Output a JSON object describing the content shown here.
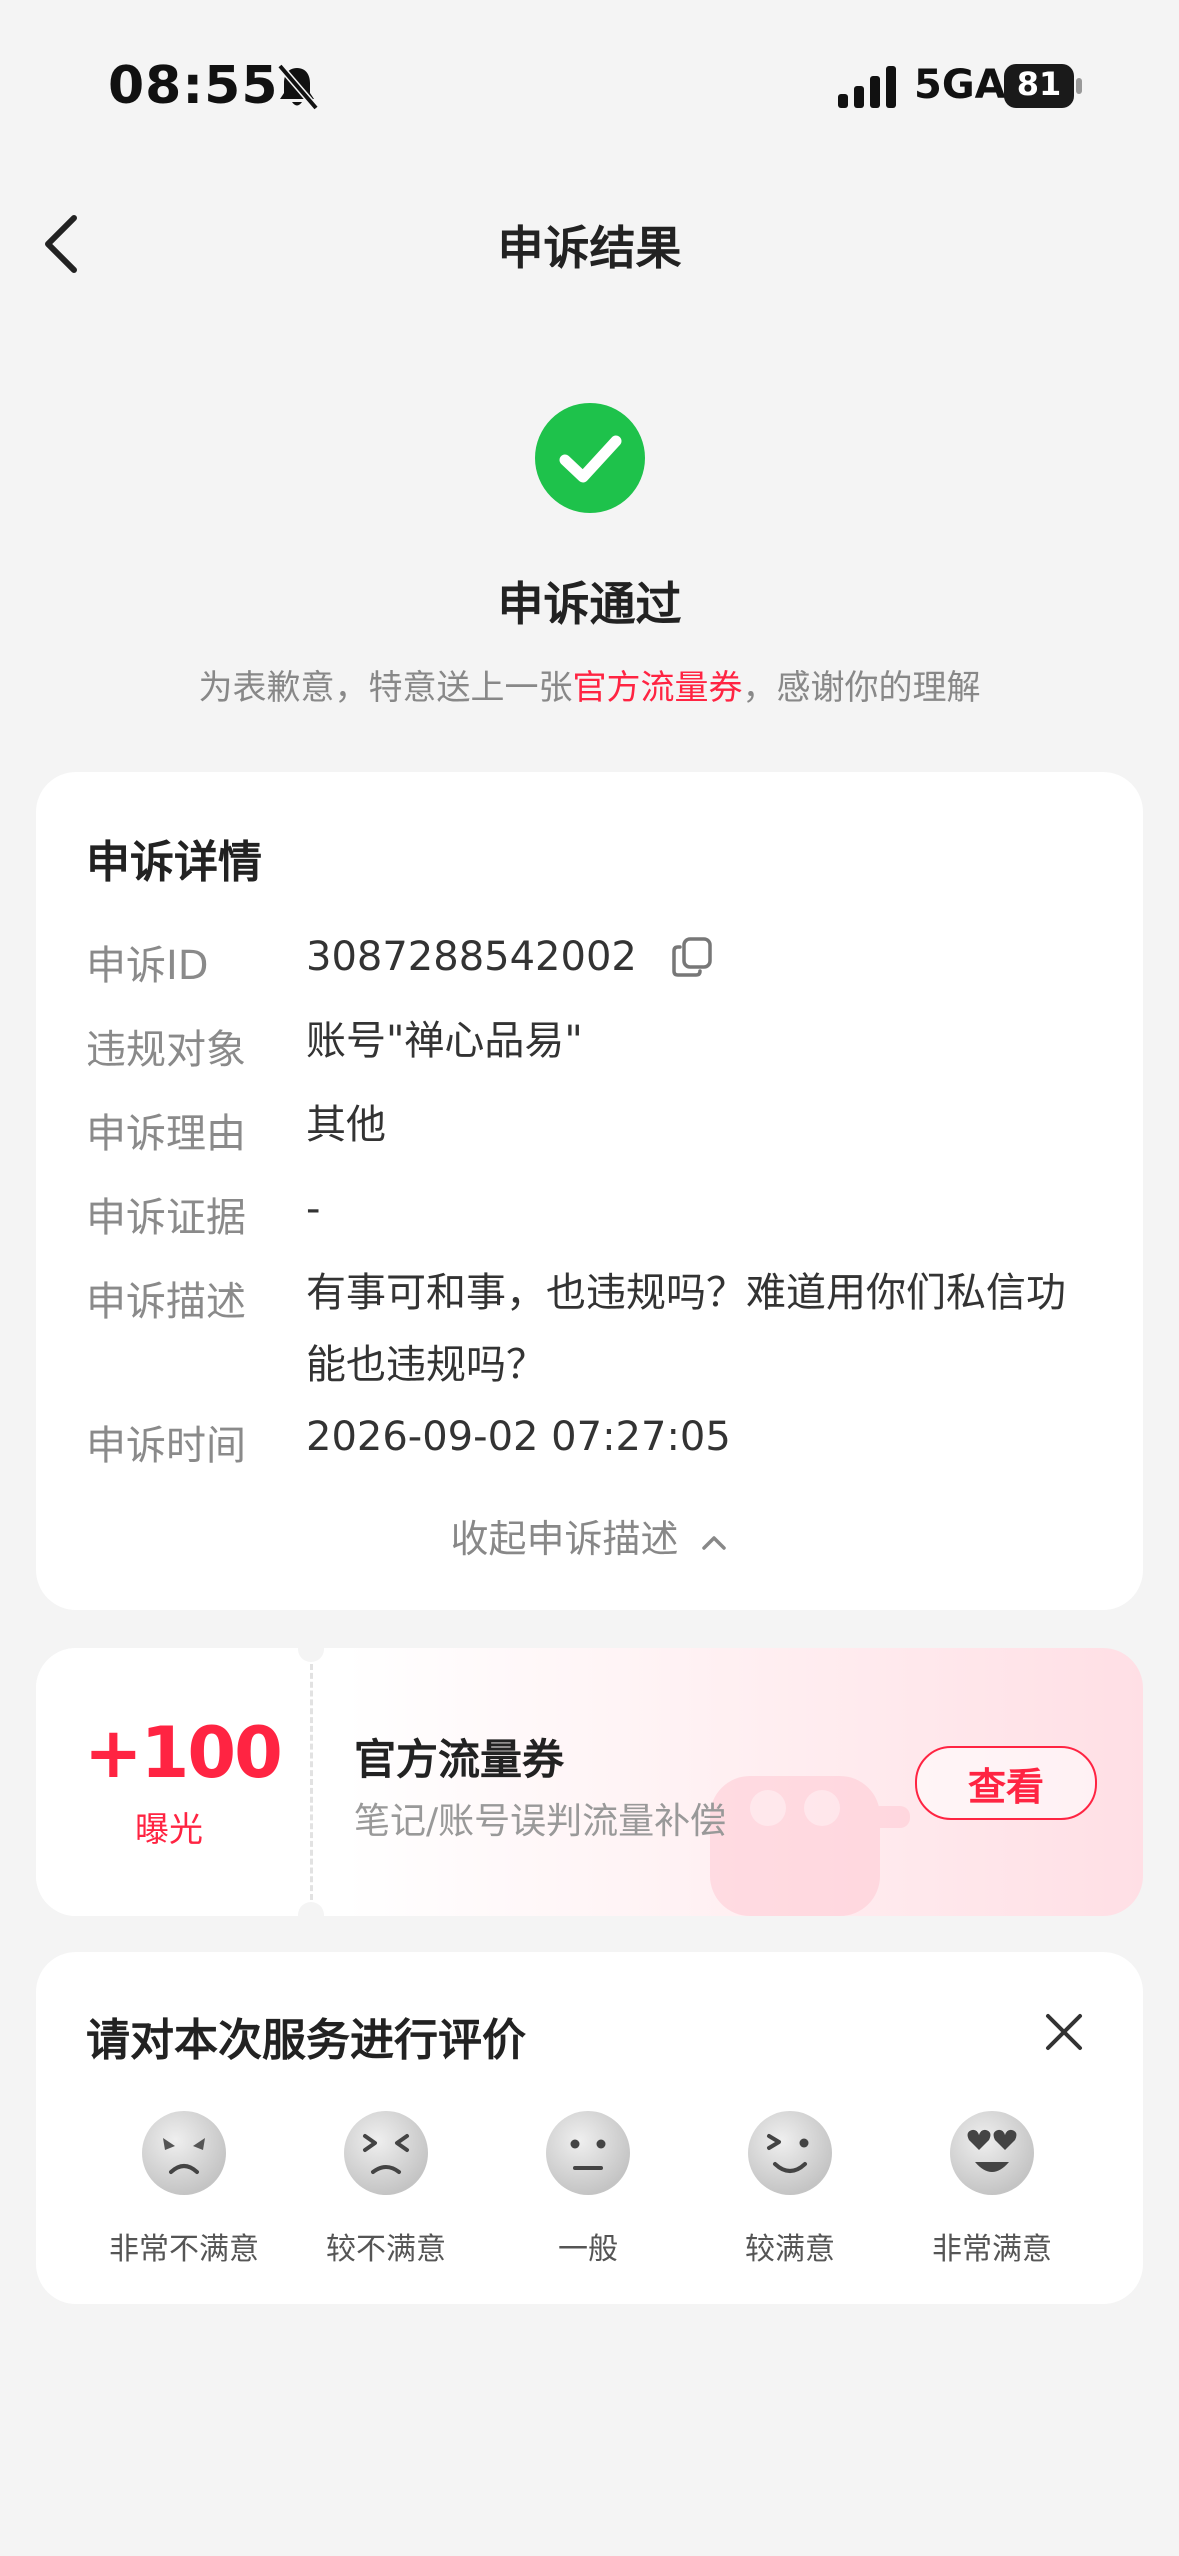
{
  "status_bar": {
    "time": "08:55",
    "network": "5GA",
    "battery": "81"
  },
  "nav": {
    "title": "申诉结果"
  },
  "result": {
    "title": "申诉通过",
    "subtitle_before": "为表歉意，特意送上一张",
    "subtitle_highlight": "官方流量券",
    "subtitle_after": "，感谢你的理解",
    "highlight_color": "#ff2442",
    "success_color": "#1ec24b"
  },
  "details": {
    "title": "申诉详情",
    "rows": [
      {
        "label": "申诉ID",
        "value": "3087288542002"
      },
      {
        "label": "违规对象",
        "value": "账号\"禅心品易\""
      },
      {
        "label": "申诉理由",
        "value": "其他"
      },
      {
        "label": "申诉证据",
        "value": "-"
      },
      {
        "label": "申诉描述",
        "value": "有事可和事，也违规吗？难道用你们私信功能也违规吗？"
      },
      {
        "label": "申诉时间",
        "value": "2026-09-02 07:27:05"
      }
    ],
    "collapse_label": "收起申诉描述"
  },
  "coupon": {
    "amount": "+100",
    "unit": "曝光",
    "name": "官方流量券",
    "description": "笔记/账号误判流量补偿",
    "button": "查看"
  },
  "rating": {
    "title": "请对本次服务进行评价",
    "options": [
      {
        "label": "非常不满意",
        "icon": "very-dissatisfied-face-icon"
      },
      {
        "label": "较不满意",
        "icon": "dissatisfied-face-icon"
      },
      {
        "label": "一般",
        "icon": "neutral-face-icon"
      },
      {
        "label": "较满意",
        "icon": "satisfied-face-icon"
      },
      {
        "label": "非常满意",
        "icon": "very-satisfied-face-icon"
      }
    ]
  }
}
